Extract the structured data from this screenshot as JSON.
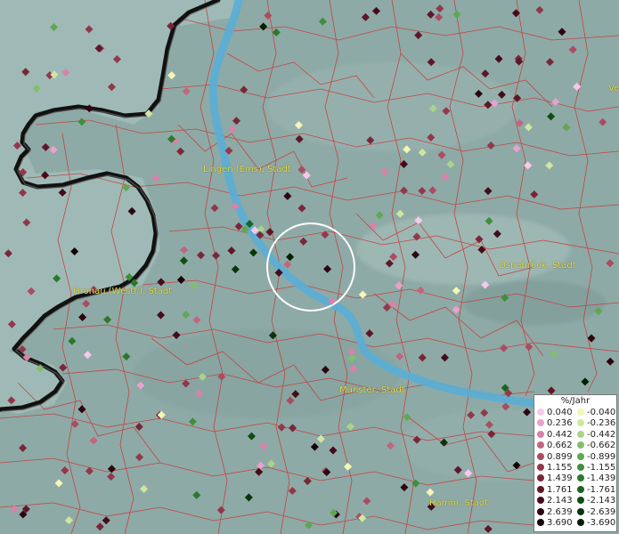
{
  "map": {
    "cities": [
      {
        "name": "Lingen (Ems), Stadt"
      },
      {
        "name": "Gronau (Westf.), Stadt"
      },
      {
        "name": "Osnabrück, Stadt"
      },
      {
        "name": "Münster, Stadt"
      },
      {
        "name": "Hamm, Stadt"
      }
    ],
    "partial_label": "Ve"
  },
  "legend": {
    "unit": "%/Jahr",
    "positive": [
      {
        "value": "0.040",
        "color": "#f8c8ec"
      },
      {
        "value": "0.236",
        "color": "#eaa0cc"
      },
      {
        "value": "0.442",
        "color": "#d882aa"
      },
      {
        "value": "0.662",
        "color": "#c2657f"
      },
      {
        "value": "0.899",
        "color": "#aa4c62"
      },
      {
        "value": "1.155",
        "color": "#92384b"
      },
      {
        "value": "1.439",
        "color": "#7a2639"
      },
      {
        "value": "1.761",
        "color": "#5e1728"
      },
      {
        "value": "2.143",
        "color": "#440c1a"
      },
      {
        "value": "2.639",
        "color": "#2c0510"
      },
      {
        "value": "3.690",
        "color": "#160007"
      }
    ],
    "negative": [
      {
        "value": "-0.040",
        "color": "#f4f6b6"
      },
      {
        "value": "-0.236",
        "color": "#d0e6a0"
      },
      {
        "value": "-0.442",
        "color": "#a9d488"
      },
      {
        "value": "-0.662",
        "color": "#82bf6c"
      },
      {
        "value": "-0.899",
        "color": "#5ea853"
      },
      {
        "value": "-1.155",
        "color": "#3f8f3c"
      },
      {
        "value": "-1.439",
        "color": "#2a7a2c"
      },
      {
        "value": "-1.761",
        "color": "#1b6320"
      },
      {
        "value": "-2.143",
        "color": "#104c15"
      },
      {
        "value": "-2.639",
        "color": "#08350c"
      },
      {
        "value": "-3.690",
        "color": "#031e05"
      }
    ]
  },
  "colors": {
    "background": "#8eaaa6",
    "boundaries": "#c83a3a",
    "river": "#5aaed6",
    "national_border": "#111111",
    "city_label": "#e6e04a",
    "highlight_circle": "#ffffff"
  }
}
